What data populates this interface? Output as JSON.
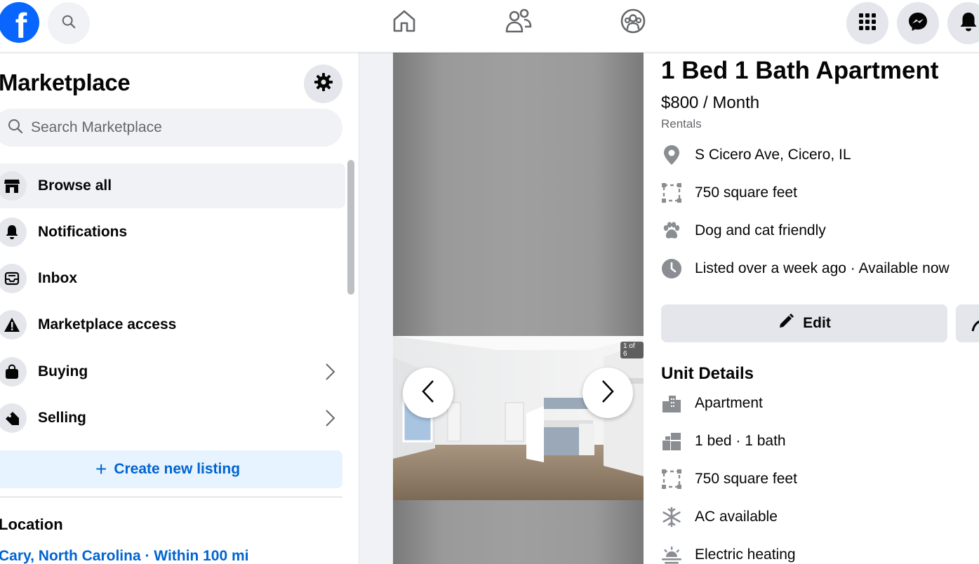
{
  "topnav": {
    "logo_letter": "f",
    "icons": [
      "search-icon",
      "home-icon",
      "friends-icon",
      "groups-icon",
      "menu-grid-icon",
      "messenger-icon",
      "notifications-icon"
    ]
  },
  "sidebar": {
    "title": "Marketplace",
    "search_placeholder": "Search Marketplace",
    "items": [
      {
        "label": "Browse all",
        "icon": "storefront-icon",
        "active": true
      },
      {
        "label": "Notifications",
        "icon": "bell-icon"
      },
      {
        "label": "Inbox",
        "icon": "inbox-icon"
      },
      {
        "label": "Marketplace access",
        "icon": "warning-icon"
      },
      {
        "label": "Buying",
        "icon": "shopping-bag-icon"
      },
      {
        "label": "Selling",
        "icon": "tag-icon"
      }
    ],
    "create_label": "Create new listing",
    "location_title": "Location",
    "location_value": "Cary, North Carolina · Within 100 mi"
  },
  "gallery": {
    "counter": "1 of 6"
  },
  "listing": {
    "title": "1 Bed 1 Bath Apartment",
    "price": "$800 / Month",
    "category": "Rentals",
    "facts": [
      {
        "icon": "location-pin-icon",
        "text": "S Cicero Ave, Cicero, IL"
      },
      {
        "icon": "square-footage-icon",
        "text": "750 square feet"
      },
      {
        "icon": "paw-icon",
        "text": "Dog and cat friendly"
      },
      {
        "icon": "clock-icon",
        "text": "Listed over a week ago · Available now"
      }
    ],
    "edit_label": "Edit",
    "unit_details_title": "Unit Details",
    "unit_details": [
      {
        "icon": "building-icon",
        "text": "Apartment"
      },
      {
        "icon": "bed-bath-icon",
        "text": "1 bed · 1 bath"
      },
      {
        "icon": "square-footage-icon",
        "text": "750 square feet"
      },
      {
        "icon": "snowflake-icon",
        "text": "AC available"
      },
      {
        "icon": "heating-icon",
        "text": "Electric heating"
      }
    ]
  },
  "colors": {
    "brand": "#0866ff",
    "link": "#0064d1",
    "secondary_text": "#65676b",
    "button_bg": "#e4e6eb"
  }
}
